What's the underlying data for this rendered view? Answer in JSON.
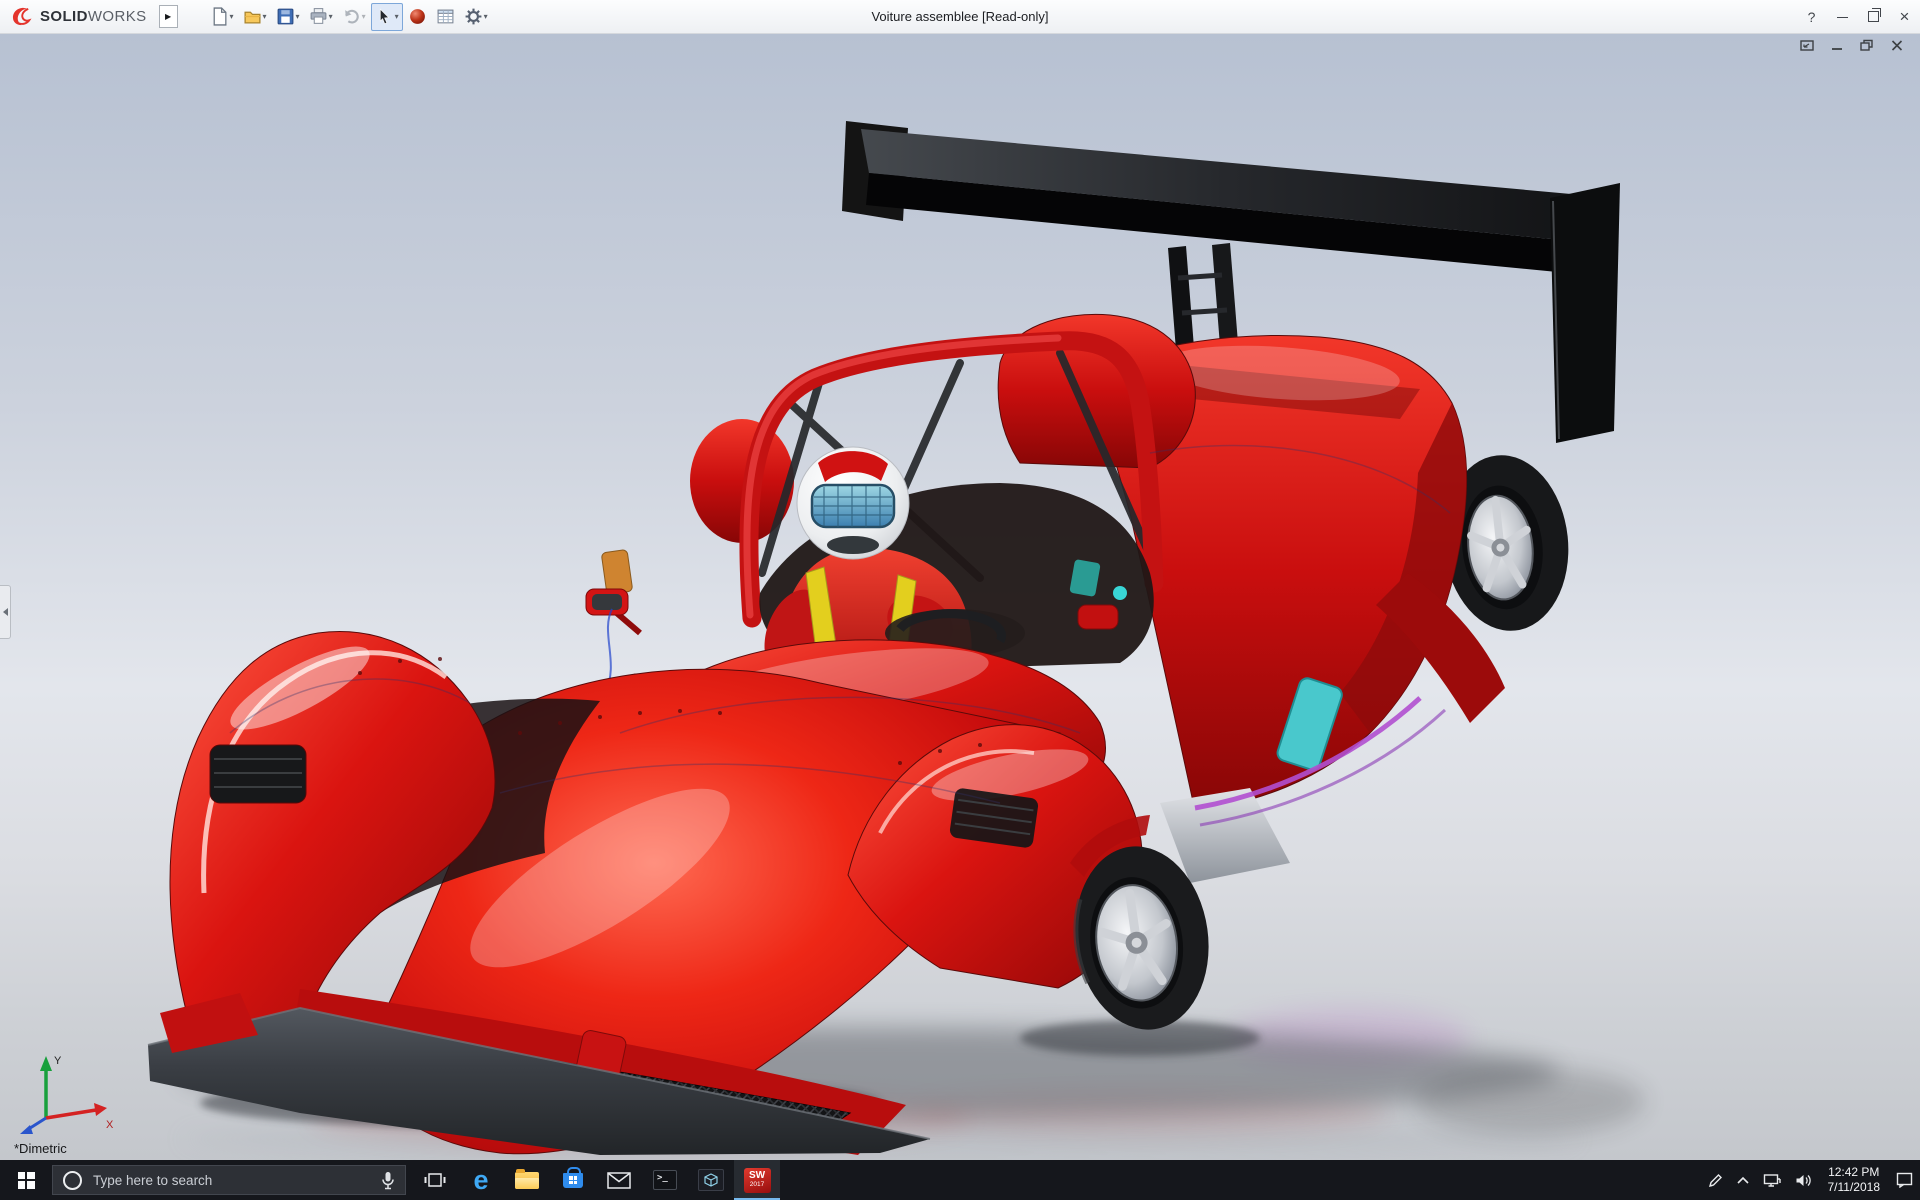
{
  "app": {
    "brand_bold": "SOLID",
    "brand_light": "WORKS",
    "title": "Voiture assemblee [Read-only]",
    "help_glyph": "?",
    "close_glyph": "×",
    "flyout_glyph": "▶"
  },
  "toolbar": {
    "caret": "▾",
    "items": [
      {
        "name": "new-document"
      },
      {
        "name": "open"
      },
      {
        "name": "save"
      },
      {
        "name": "print"
      },
      {
        "name": "undo"
      },
      {
        "name": "select"
      },
      {
        "name": "appearance-sphere"
      },
      {
        "name": "design-table"
      },
      {
        "name": "options-gear"
      }
    ]
  },
  "viewport": {
    "view_orientation": "*Dimetric",
    "triad": {
      "x_label": "X",
      "y_label": "Y"
    },
    "model": "red open-cockpit race car assembly with rear wing and driver"
  },
  "taskbar": {
    "search_placeholder": "Type here to search",
    "edge_glyph": "e",
    "console_glyph": ">_",
    "sw_line1": "SW",
    "sw_line2": "2017",
    "clock_time": "12:42 PM",
    "clock_date": "7/11/2018"
  },
  "colors": {
    "car_red": "#d01010",
    "wing_black": "#141414",
    "taskbar_bg": "#15171c",
    "selection_accent": "#7da7d9",
    "viewport_top": "#b7c1d2"
  }
}
